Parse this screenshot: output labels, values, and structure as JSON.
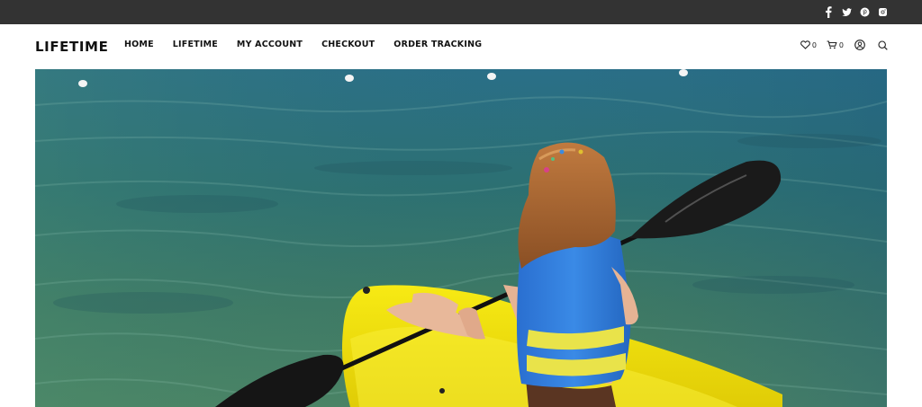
{
  "brand": {
    "name": "LIFETIME"
  },
  "nav": {
    "items": [
      {
        "label": "HOME"
      },
      {
        "label": "LIFETIME"
      },
      {
        "label": "MY ACCOUNT"
      },
      {
        "label": "CHECKOUT"
      },
      {
        "label": "ORDER TRACKING"
      }
    ]
  },
  "topbar": {
    "social_icons": [
      "facebook-icon",
      "twitter-icon",
      "pinterest-icon",
      "instagram-icon"
    ]
  },
  "tools": {
    "wishlist_count": "0",
    "cart_count": "0",
    "icons": [
      "heart-icon",
      "cart-icon",
      "user-icon",
      "search-icon"
    ]
  },
  "hero": {
    "image": "girl-in-yellow-kayak-on-water"
  },
  "colors": {
    "topbar_bg": "#333333",
    "header_bg": "#ffffff",
    "text": "#111111",
    "water": "#2f6b6a",
    "kayak": "#f2e30a",
    "life_vest": "#2f7fd6"
  }
}
